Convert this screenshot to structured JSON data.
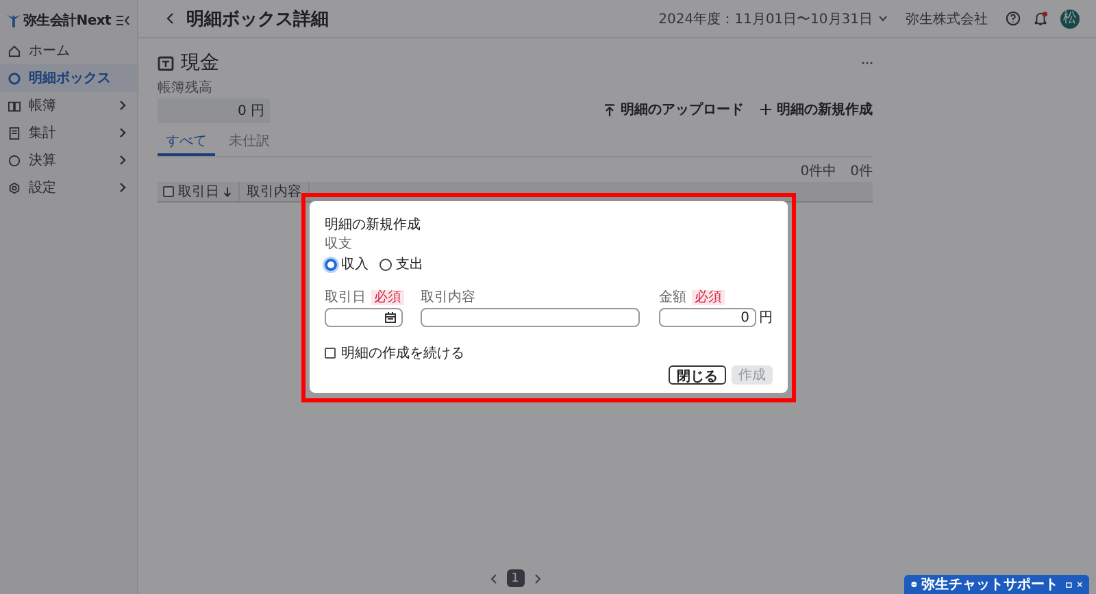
{
  "sidebar": {
    "logo": "弥生会計Next",
    "items": [
      {
        "label": "ホーム",
        "selected": false,
        "expandable": false
      },
      {
        "label": "明細ボックス",
        "selected": true,
        "expandable": false
      },
      {
        "label": "帳簿",
        "selected": false,
        "expandable": true
      },
      {
        "label": "集計",
        "selected": false,
        "expandable": true
      },
      {
        "label": "決算",
        "selected": false,
        "expandable": true
      },
      {
        "label": "設定",
        "selected": false,
        "expandable": true
      }
    ]
  },
  "header": {
    "title": "明細ボックス詳細",
    "fiscal_period": "2024年度：11月01日〜10月31日",
    "company": "弥生株式会社",
    "avatar": "松",
    "has_notification": true
  },
  "page": {
    "title": "現金",
    "balance_label": "帳簿残高",
    "balance": "0 円",
    "actions": [
      {
        "label": "明細のアップロード"
      },
      {
        "label": "明細の新規作成"
      }
    ],
    "tabs": [
      {
        "label": "すべて",
        "selected": true
      },
      {
        "label": "未仕訳",
        "selected": false
      }
    ],
    "count": "0件中　0件",
    "table": {
      "columns": [
        {
          "label": "取引日",
          "sorted": true
        },
        {
          "label": "取引内容",
          "sorted": false
        }
      ],
      "all_checked": false
    }
  },
  "pagination": {
    "pages": [
      {
        "label": "1",
        "selected": true
      }
    ]
  },
  "modal": {
    "title": "明細の新規作成",
    "type_label": "収支",
    "types": [
      {
        "label": "収入",
        "selected": true
      },
      {
        "label": "支出",
        "selected": false
      }
    ],
    "fields": [
      {
        "kind": "date",
        "label": "取引日",
        "badge": "必須"
      },
      {
        "kind": "text",
        "label": "取引内容"
      },
      {
        "kind": "amount",
        "label": "金額",
        "badge": "必須",
        "value": "0",
        "unit": "円"
      }
    ],
    "continue": {
      "label": "明細の作成を続ける",
      "checked": false
    },
    "buttons": [
      {
        "label": "閉じる",
        "kind": "secondary",
        "disabled": false
      },
      {
        "label": "作成",
        "kind": "primary",
        "disabled": true
      }
    ]
  },
  "chat": {
    "label": "弥生チャットサポート"
  }
}
